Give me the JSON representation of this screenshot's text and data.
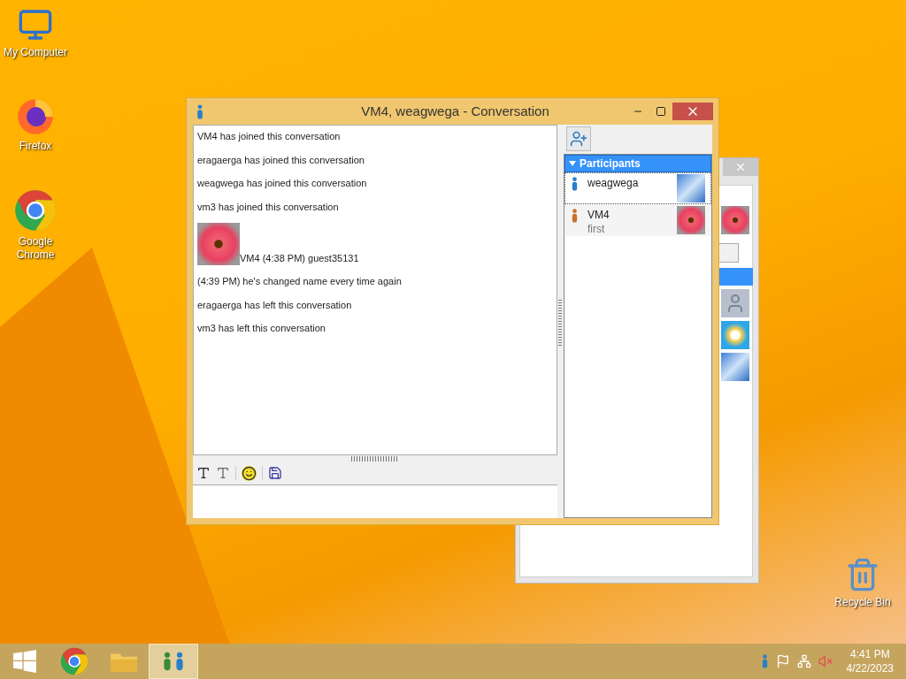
{
  "desktop_icons": [
    {
      "kind": "computer",
      "label": "My Computer"
    },
    {
      "kind": "firefox",
      "label": "Firefox"
    },
    {
      "kind": "chrome",
      "label": "Google Chrome"
    },
    {
      "kind": "recycle",
      "label": "Recycle Bin"
    }
  ],
  "conversation_window": {
    "title": "VM4, weagwega - Conversation",
    "messages": [
      {
        "kind": "text",
        "text": "VM4 has joined this conversation"
      },
      {
        "kind": "text",
        "text": "eragaerga has joined this conversation"
      },
      {
        "kind": "text",
        "text": "weagwega has joined this conversation"
      },
      {
        "kind": "text",
        "text": "vm3 has joined this conversation"
      },
      {
        "kind": "photo",
        "text": "VM4 (4:38 PM) guest35131"
      },
      {
        "kind": "text",
        "text": "(4:39 PM) he's changed name every time again"
      },
      {
        "kind": "text",
        "text": "eragaerga has left this conversation"
      },
      {
        "kind": "text",
        "text": "vm3 has left this conversation"
      }
    ],
    "participants": {
      "header": "Participants",
      "expanded": true,
      "items": [
        {
          "name": "weagwega",
          "color": "#2a7fc9",
          "selected": true
        },
        {
          "name": "VM4",
          "status": "first",
          "color": "#c8702a",
          "selected": false
        }
      ]
    }
  },
  "taskbar": {
    "items": [
      {
        "kind": "start",
        "selected": false
      },
      {
        "kind": "chrome",
        "selected": false
      },
      {
        "kind": "explorer",
        "selected": false
      },
      {
        "kind": "messenger",
        "selected": true
      }
    ],
    "time": "4:41 PM",
    "date": "4/22/2023"
  }
}
